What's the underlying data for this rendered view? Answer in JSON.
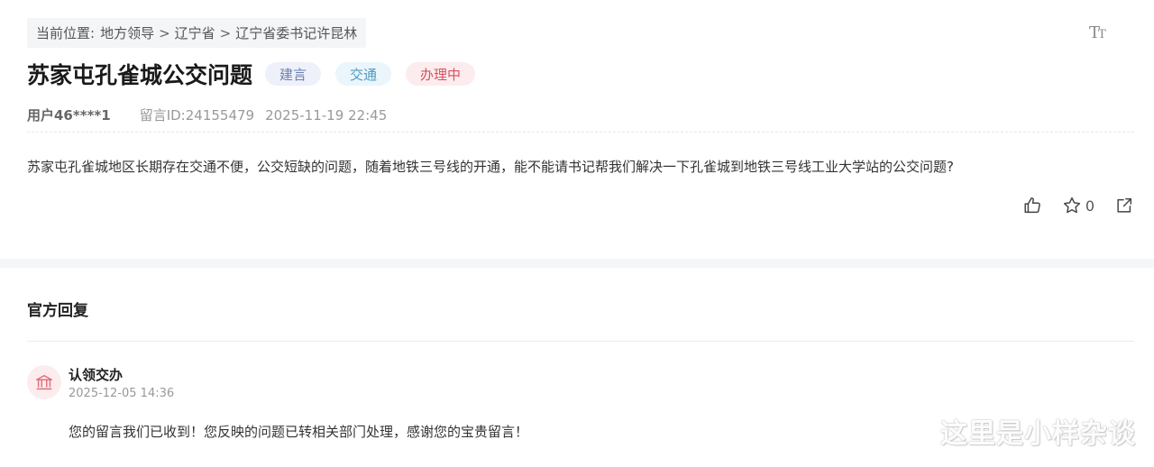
{
  "breadcrumb": {
    "prefix": "当前位置:",
    "items": [
      "地方领导",
      "辽宁省",
      "辽宁省委书记许昆林"
    ],
    "separator": ">"
  },
  "font_toggle_label": "TT",
  "post": {
    "title": "苏家屯孔雀城公交问题",
    "tags": [
      {
        "label": "建言",
        "color": "#6b7fb5"
      },
      {
        "label": "交通",
        "color": "#4f99c0"
      },
      {
        "label": "办理中",
        "color": "#d9505f"
      }
    ],
    "user": "用户46****1",
    "message_id": "留言ID:24155479",
    "datetime": "2025-11-19 22:45",
    "content": "苏家屯孔雀城地区长期存在交通不便，公交短缺的问题，随着地铁三号线的开通，能不能请书记帮我们解决一下孔雀城到地铁三号线工业大学站的公交问题?",
    "actions": {
      "like_icon": "thumbs-up-icon",
      "favorite_icon": "star-icon",
      "favorite_count": "0",
      "share_icon": "share-icon"
    }
  },
  "reply": {
    "section_title": "官方回复",
    "avatar_icon": "government-building-icon",
    "org": "认领交办",
    "time": "2025-12-05 14:36",
    "text": "您的留言我们已收到！您反映的问题已转相关部门处理，感谢您的宝贵留言！"
  },
  "watermark": "这里是小样杂谈"
}
